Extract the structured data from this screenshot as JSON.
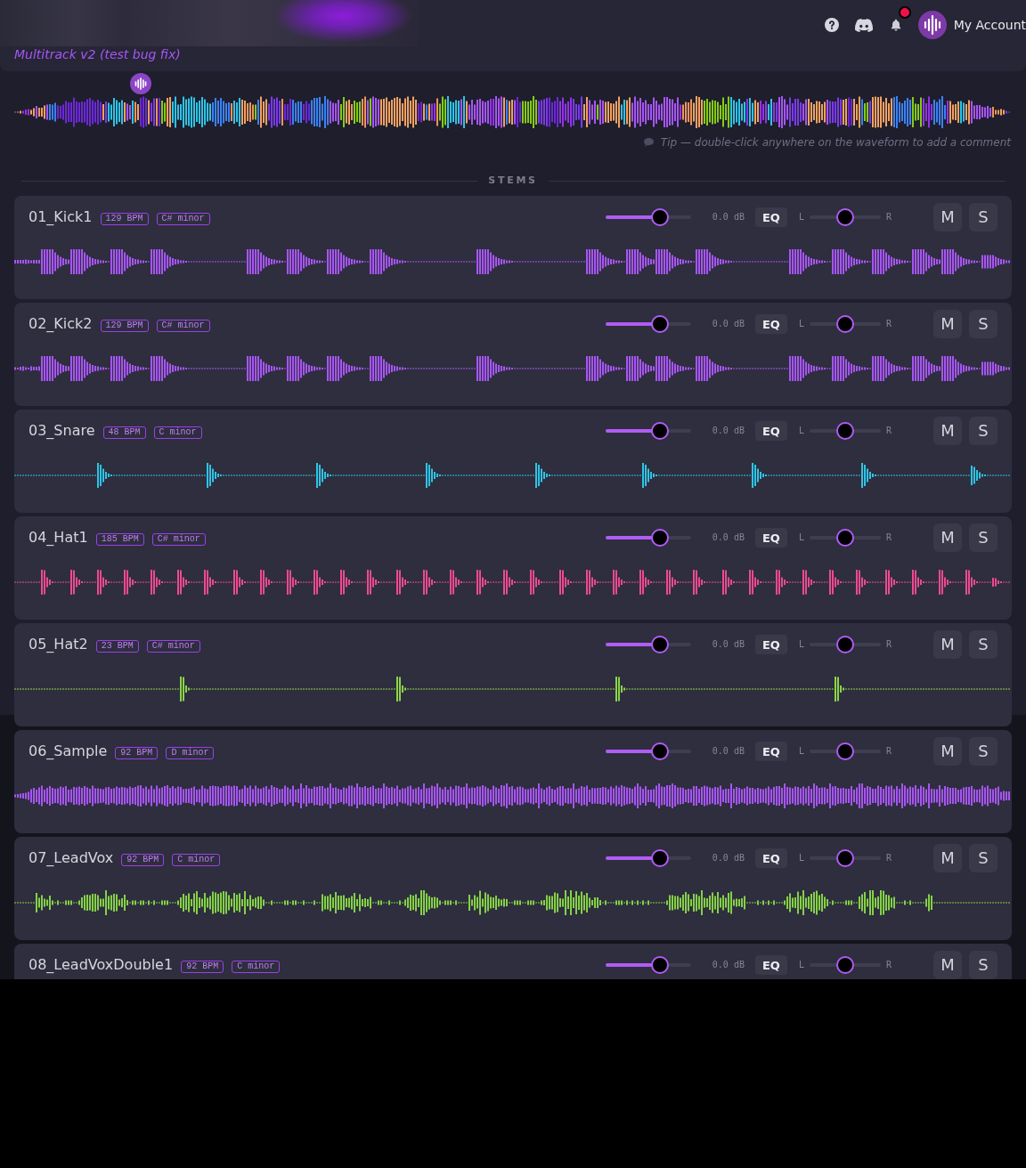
{
  "header": {
    "title": "Multitrack v2 (test bug fix)",
    "account": "My Account",
    "notifications_unread": true
  },
  "overview": {
    "tip": "Tip — double-click anywhere on the waveform to add a comment"
  },
  "stems_heading": "STEMS",
  "stems": [
    {
      "name": "01_Kick1",
      "bpm": "129 BPM",
      "key": "C# minor",
      "kind": "kick",
      "color": "#a855f7",
      "volume": {
        "level": 0.64
      },
      "reading": "0.0 dB",
      "eq_label": "EQ",
      "pan_left": "L",
      "pan": {
        "level": 0.5
      },
      "pan_right": "R",
      "mute_label": "M",
      "muted": false,
      "solo_label": "S",
      "soloed": false
    },
    {
      "name": "02_Kick2",
      "bpm": "129 BPM",
      "key": "C# minor",
      "kind": "kick",
      "color": "#a855f7",
      "volume": {
        "level": 0.64
      },
      "reading": "0.0 dB",
      "eq_label": "EQ",
      "pan_left": "L",
      "pan": {
        "level": 0.5
      },
      "pan_right": "R",
      "mute_label": "M",
      "muted": false,
      "solo_label": "S",
      "soloed": false
    },
    {
      "name": "03_Snare",
      "bpm": "48 BPM",
      "key": "C minor",
      "kind": "snare",
      "color": "#2ec4e6",
      "volume": {
        "level": 0.64
      },
      "reading": "0.0 dB",
      "eq_label": "EQ",
      "pan_left": "L",
      "pan": {
        "level": 0.5
      },
      "pan_right": "R",
      "mute_label": "M",
      "muted": false,
      "solo_label": "S",
      "soloed": false
    },
    {
      "name": "04_Hat1",
      "bpm": "185 BPM",
      "key": "C# minor",
      "kind": "hat",
      "color": "#ee4a92",
      "volume": {
        "level": 0.64
      },
      "reading": "0.0 dB",
      "eq_label": "EQ",
      "pan_left": "L",
      "pan": {
        "level": 0.5
      },
      "pan_right": "R",
      "mute_label": "M",
      "muted": false,
      "solo_label": "S",
      "soloed": false
    },
    {
      "name": "05_Hat2",
      "bpm": "23 BPM",
      "key": "C# minor",
      "kind": "perc",
      "color": "#8bd448",
      "volume": {
        "level": 0.64
      },
      "reading": "0.0 dB",
      "eq_label": "EQ",
      "pan_left": "L",
      "pan": {
        "level": 0.5
      },
      "pan_right": "R",
      "mute_label": "M",
      "muted": false,
      "solo_label": "S",
      "soloed": false
    },
    {
      "name": "06_Sample",
      "bpm": "92 BPM",
      "key": "D minor",
      "kind": "sample",
      "color": "#a855f7",
      "volume": {
        "level": 0.64
      },
      "reading": "0.0 dB",
      "eq_label": "EQ",
      "pan_left": "L",
      "pan": {
        "level": 0.5
      },
      "pan_right": "R",
      "mute_label": "M",
      "muted": false,
      "solo_label": "S",
      "soloed": false
    },
    {
      "name": "07_LeadVox",
      "bpm": "92 BPM",
      "key": "C minor",
      "kind": "vocal",
      "color": "#84d147",
      "volume": {
        "level": 0.64
      },
      "reading": "0.0 dB",
      "eq_label": "EQ",
      "pan_left": "L",
      "pan": {
        "level": 0.5
      },
      "pan_right": "R",
      "mute_label": "M",
      "muted": false,
      "solo_label": "S",
      "soloed": false
    },
    {
      "name": "08_LeadVoxDouble1",
      "bpm": "92 BPM",
      "key": "C minor",
      "volume": {
        "level": 0.64
      },
      "reading": "0.0 dB",
      "eq_label": "EQ",
      "pan_left": "L",
      "pan": {
        "level": 0.5
      },
      "pan_right": "R",
      "mute_label": "M",
      "muted": false,
      "solo_label": "S",
      "soloed": false
    }
  ]
}
